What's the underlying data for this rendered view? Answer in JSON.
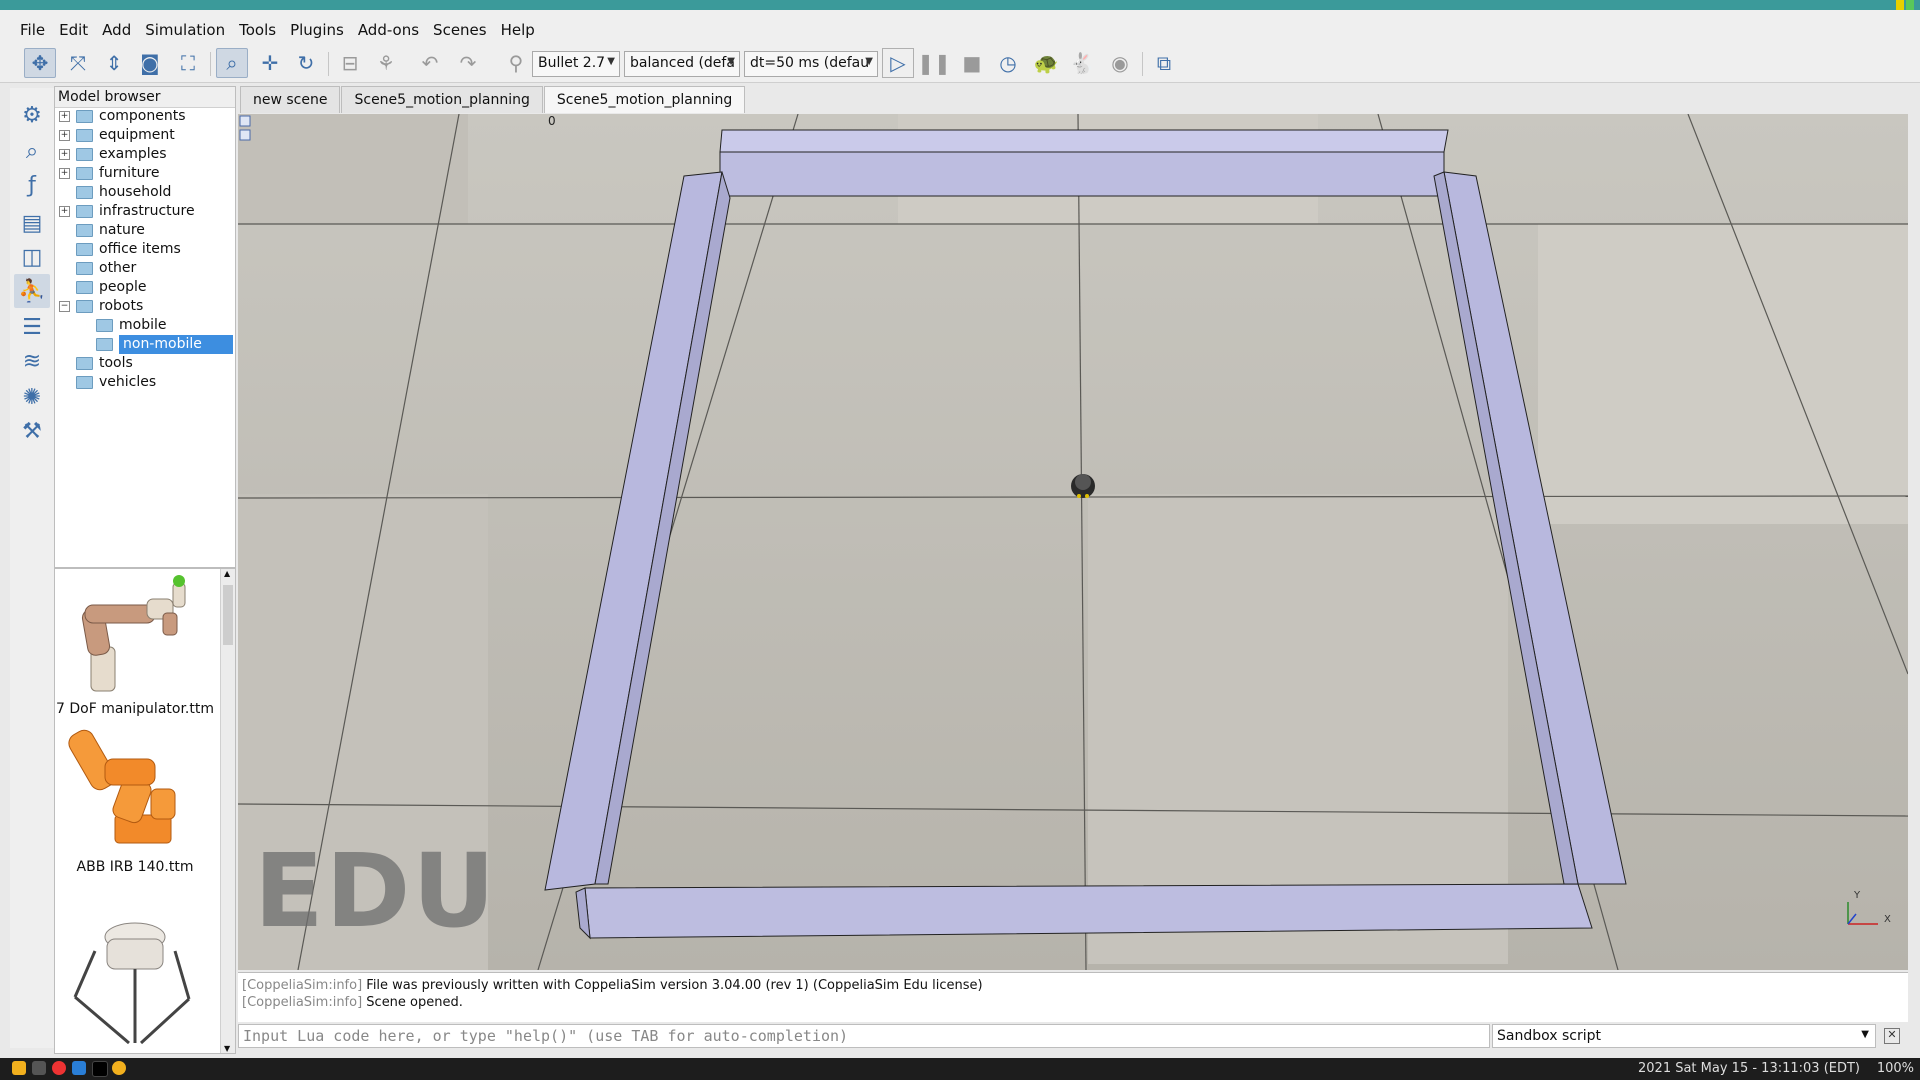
{
  "menu": [
    "File",
    "Edit",
    "Add",
    "Simulation",
    "Tools",
    "Plugins",
    "Add-ons",
    "Scenes",
    "Help"
  ],
  "toolbar": {
    "engine": "Bullet 2.7",
    "accuracy": "balanced (defa",
    "timestep": "dt=50 ms (defau"
  },
  "model_browser": {
    "title": "Model browser",
    "items": [
      {
        "label": "components",
        "expandable": true
      },
      {
        "label": "equipment",
        "expandable": true
      },
      {
        "label": "examples",
        "expandable": true
      },
      {
        "label": "furniture",
        "expandable": true
      },
      {
        "label": "household",
        "expandable": false
      },
      {
        "label": "infrastructure",
        "expandable": true
      },
      {
        "label": "nature",
        "expandable": false
      },
      {
        "label": "office items",
        "expandable": false
      },
      {
        "label": "other",
        "expandable": false
      },
      {
        "label": "people",
        "expandable": false
      },
      {
        "label": "robots",
        "expandable": true,
        "expanded": true
      },
      {
        "label": "mobile",
        "child": true
      },
      {
        "label": "non-mobile",
        "child": true,
        "selected": true
      },
      {
        "label": "tools",
        "expandable": false
      },
      {
        "label": "vehicles",
        "expandable": false
      }
    ],
    "thumbnails": [
      "7 DoF manipulator.ttm",
      "ABB IRB 140.ttm"
    ]
  },
  "tabs": [
    "new scene",
    "Scene5_motion_planning",
    "Scene5_motion_planning"
  ],
  "viewport": {
    "watermark": "EDU",
    "corner_number": "0",
    "axis_y": "Y",
    "axis_x": "X"
  },
  "console": {
    "line1_tag": "[CoppeliaSim:info]",
    "line1_text": " File was previously written with CoppeliaSim version 3.04.00 (rev 1) (CoppeliaSim Edu license)",
    "line2_tag": "[CoppeliaSim:info]",
    "line2_text": " Scene opened."
  },
  "lua_input": {
    "placeholder": "Input Lua code here, or type \"help()\" (use TAB for auto-completion)"
  },
  "script_selector": "Sandbox script",
  "taskbar": {
    "clock": "2021 Sat May 15 - 13:11:03 (EDT)",
    "zoom": "100%"
  }
}
